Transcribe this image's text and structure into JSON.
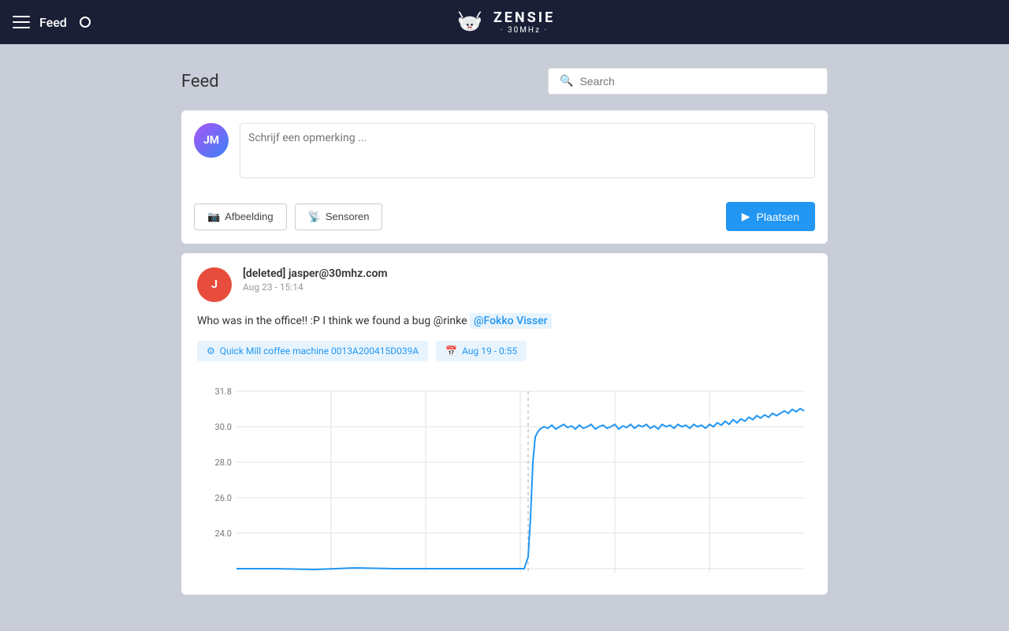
{
  "navbar": {
    "menu_label": "☰",
    "title": "Feed",
    "brand_name": "ZENSIE",
    "brand_sub": "· 30MHz ·"
  },
  "header": {
    "page_title": "Feed",
    "search_placeholder": "Search"
  },
  "composer": {
    "avatar_initials": "JM",
    "textarea_placeholder": "Schrijf een opmerking ...",
    "btn_image": "Afbeelding",
    "btn_sensors": "Sensoren",
    "btn_submit": "Plaatsen"
  },
  "post": {
    "avatar_initial": "J",
    "author": "[deleted] jasper@30mhz.com",
    "time": "Aug 23 - 15:14",
    "body_text": "Who was in the office!! :P I think we found a bug @rinke",
    "mention": "@Fokko Visser",
    "tag_sensor": "Quick Mill coffee machine 0013A200415D039A",
    "tag_date": "Aug 19 - 0:55"
  },
  "chart": {
    "y_labels": [
      "31.8",
      "30.0",
      "28.0",
      "26.0",
      "24.0"
    ]
  }
}
